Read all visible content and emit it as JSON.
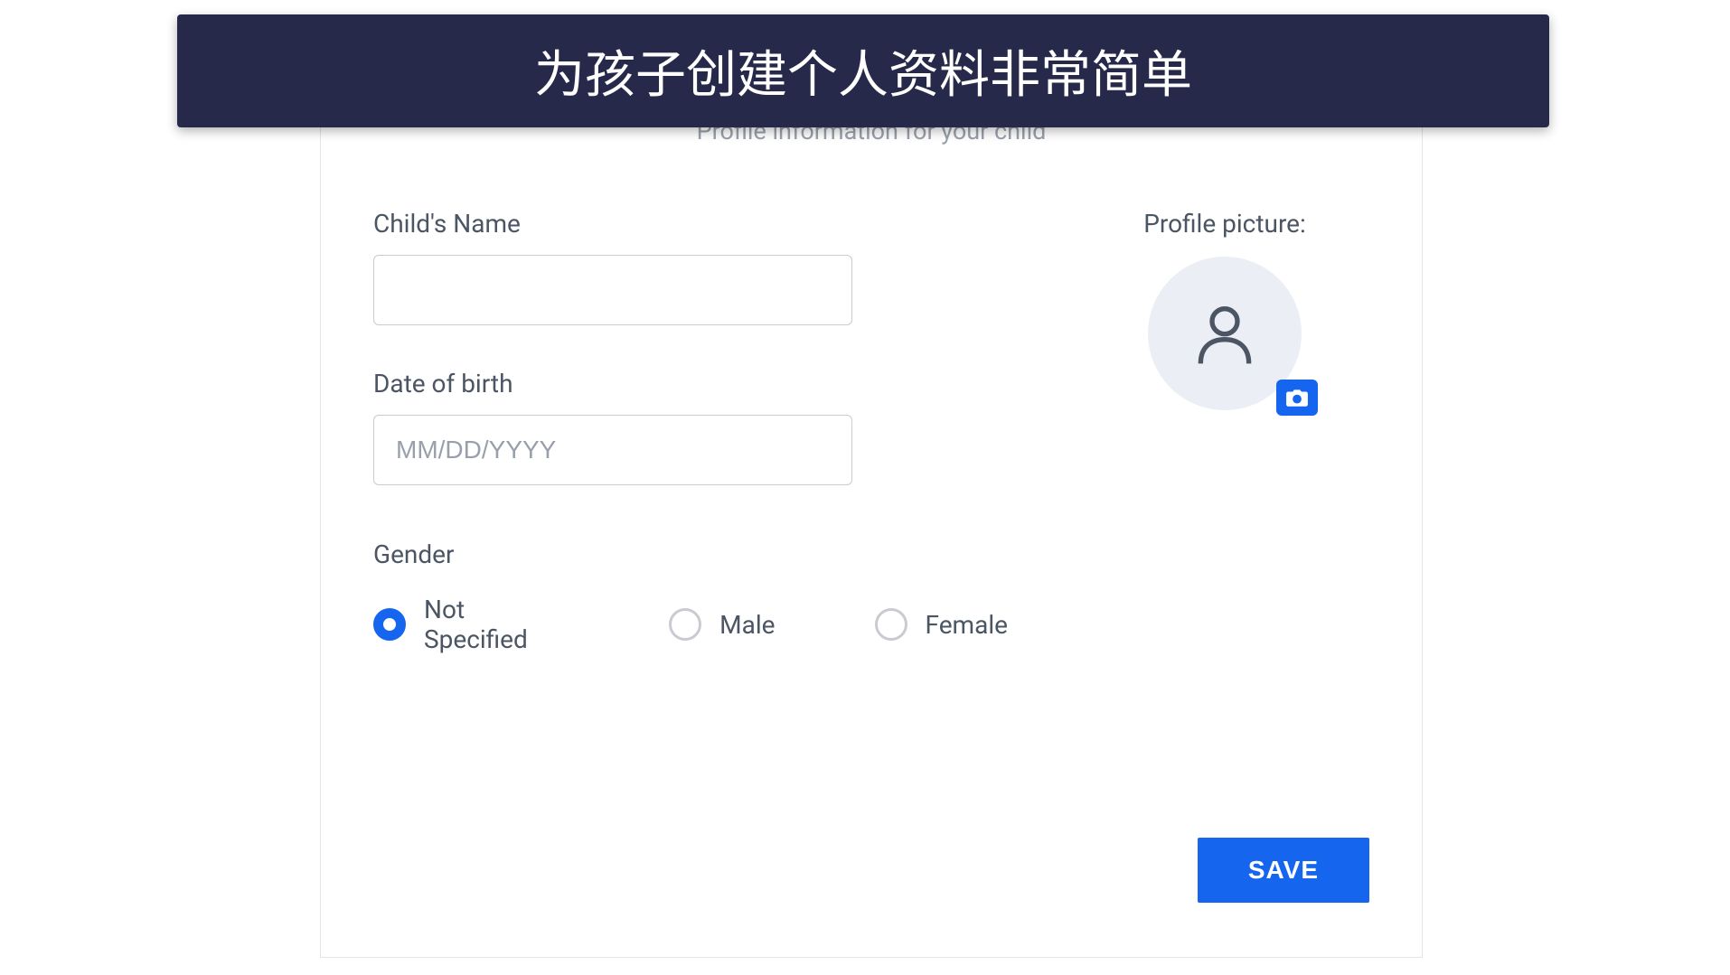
{
  "banner": {
    "title": "为孩子创建个人资料非常简单"
  },
  "form": {
    "subtitle": "Profile information for your child",
    "childName": {
      "label": "Child's Name",
      "value": ""
    },
    "dateOfBirth": {
      "label": "Date of birth",
      "placeholder": "MM/DD/YYYY",
      "value": ""
    },
    "gender": {
      "label": "Gender",
      "options": [
        {
          "label": "Not Specified",
          "selected": true
        },
        {
          "label": "Male",
          "selected": false
        },
        {
          "label": "Female",
          "selected": false
        }
      ]
    },
    "profilePicture": {
      "label": "Profile picture:"
    },
    "saveButton": {
      "label": "SAVE"
    }
  }
}
